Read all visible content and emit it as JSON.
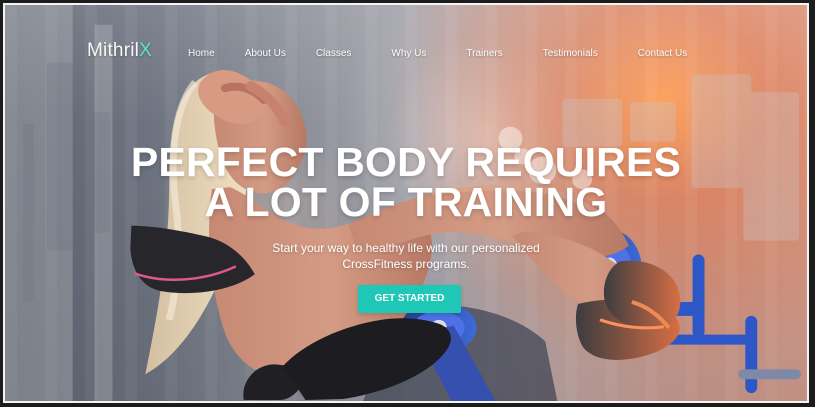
{
  "brand": {
    "name_main": "Mithril",
    "name_accent": "X"
  },
  "nav": {
    "items": [
      {
        "label": "Home"
      },
      {
        "label": "About Us"
      },
      {
        "label": "Classes"
      },
      {
        "label": "Why Us"
      },
      {
        "label": "Trainers"
      },
      {
        "label": "Testimonials"
      },
      {
        "label": "Contact Us"
      }
    ]
  },
  "hero": {
    "title_line_1": "PERFECT BODY REQUIRES",
    "title_line_2": "A LOT OF TRAINING",
    "subtitle_line_1": "Start your way to healthy life with our personalized",
    "subtitle_line_2": "CrossFitness programs.",
    "cta_label": "GET STARTED"
  },
  "colors": {
    "accent": "#1fc7b6",
    "logo_accent": "#5de1c7"
  }
}
